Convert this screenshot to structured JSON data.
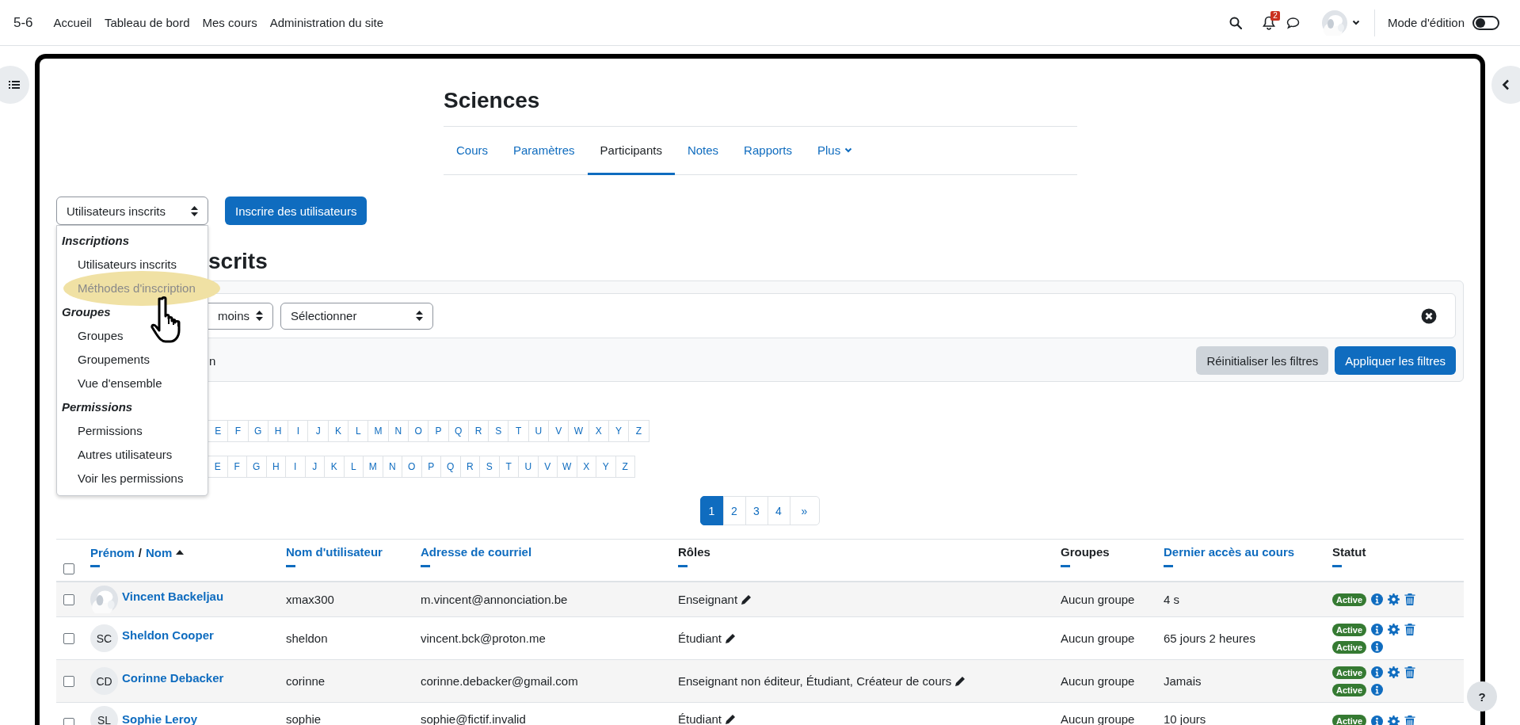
{
  "top_bar": {
    "site": "5-6",
    "nav": [
      "Accueil",
      "Tableau de bord",
      "Mes cours",
      "Administration du site"
    ],
    "notification_count": "2",
    "edit_mode": {
      "label": "Mode d'édition",
      "on": false
    }
  },
  "course": {
    "title": "Sciences",
    "tabs": [
      {
        "label": "Cours",
        "selected": false,
        "kind": "link"
      },
      {
        "label": "Paramètres",
        "selected": false,
        "kind": "link"
      },
      {
        "label": "Participants",
        "selected": true,
        "kind": "link"
      },
      {
        "label": "Notes",
        "selected": false,
        "kind": "link"
      },
      {
        "label": "Rapports",
        "selected": false,
        "kind": "link"
      },
      {
        "label": "Plus",
        "selected": false,
        "kind": "dropdown"
      }
    ]
  },
  "enrol_select": {
    "value": "Utilisateurs inscrits"
  },
  "enrol_button": "Inscrire des utilisateurs",
  "menu": {
    "groups": [
      {
        "heading": "Inscriptions",
        "items": [
          {
            "label": "Utilisateurs inscrits",
            "highlighted": false
          },
          {
            "label": "Méthodes d'inscription",
            "highlighted": true
          }
        ]
      },
      {
        "heading": "Groupes",
        "items": [
          {
            "label": "Groupes",
            "highlighted": false
          },
          {
            "label": "Groupements",
            "highlighted": false
          },
          {
            "label": "Vue d'ensemble",
            "highlighted": false
          }
        ]
      },
      {
        "heading": "Permissions",
        "items": [
          {
            "label": "Permissions",
            "highlighted": false
          },
          {
            "label": "Autres utilisateurs",
            "highlighted": false
          },
          {
            "label": "Voir les permissions",
            "highlighted": false
          }
        ]
      }
    ]
  },
  "heading_fragment": "scrits",
  "filters": {
    "match_fragment": "moins",
    "type_select": "Sélectionner",
    "row_fragment": "n",
    "reset": "Réinitialiser les filtres",
    "apply": "Appliquer les filtres"
  },
  "alphabet_rows": [
    [
      "E",
      "F",
      "G",
      "H",
      "I",
      "J",
      "K",
      "L",
      "M",
      "N",
      "O",
      "P",
      "Q",
      "R",
      "S",
      "T",
      "U",
      "V",
      "W",
      "X",
      "Y",
      "Z"
    ],
    [
      "E",
      "F",
      "G",
      "H",
      "I",
      "J",
      "K",
      "L",
      "M",
      "N",
      "O",
      "P",
      "Q",
      "R",
      "S",
      "T",
      "U",
      "V",
      "W",
      "X",
      "Y",
      "Z"
    ]
  ],
  "pagination": [
    {
      "label": "1",
      "selected": true
    },
    {
      "label": "2",
      "selected": false
    },
    {
      "label": "3",
      "selected": false
    },
    {
      "label": "4",
      "selected": false
    },
    {
      "label": "»",
      "selected": false
    }
  ],
  "table": {
    "select_all": false,
    "name_column": {
      "first": "Prénom",
      "separator": "/",
      "last": "Nom",
      "sorted_ascending": true
    },
    "columns": [
      {
        "label": "Nom d'utilisateur",
        "sortable": true
      },
      {
        "label": "Adresse de courriel",
        "sortable": true
      },
      {
        "label": "Rôles",
        "sortable": false
      },
      {
        "label": "Groupes",
        "sortable": false
      },
      {
        "label": "Dernier accès au cours",
        "sortable": true
      },
      {
        "label": "Statut",
        "sortable": false
      }
    ],
    "rows": [
      {
        "selected": false,
        "avatar": {
          "kind": "picture"
        },
        "name": "Vincent Backeljau",
        "username": "xmax300",
        "email": "m.vincent@annonciation.be",
        "roles": "Enseignant",
        "groups": "Aucun groupe",
        "last_access": "4 s",
        "enrolments": [
          {
            "status": "Active",
            "editable": true
          }
        ]
      },
      {
        "selected": false,
        "avatar": {
          "kind": "initials",
          "text": "SC"
        },
        "name": "Sheldon Cooper",
        "username": "sheldon",
        "email": "vincent.bck@proton.me",
        "roles": "Étudiant",
        "groups": "Aucun groupe",
        "last_access": "65 jours 2 heures",
        "enrolments": [
          {
            "status": "Active",
            "editable": true
          },
          {
            "status": "Active",
            "editable": false
          }
        ]
      },
      {
        "selected": false,
        "avatar": {
          "kind": "initials",
          "text": "CD"
        },
        "name": "Corinne Debacker",
        "username": "corinne",
        "email": "corinne.debacker@gmail.com",
        "roles": "Enseignant non éditeur, Étudiant, Créateur de cours",
        "groups": "Aucun groupe",
        "last_access": "Jamais",
        "enrolments": [
          {
            "status": "Active",
            "editable": true
          },
          {
            "status": "Active",
            "editable": false
          }
        ]
      },
      {
        "selected": false,
        "avatar": {
          "kind": "initials",
          "text": "SL"
        },
        "name": "Sophie Leroy",
        "username": "sophie",
        "email": "sophie@fictif.invalid",
        "roles": "Étudiant",
        "groups": "Aucun groupe",
        "last_access": "10 jours",
        "enrolments": [
          {
            "status": "Active",
            "editable": true
          }
        ]
      }
    ]
  },
  "help_button": "?"
}
